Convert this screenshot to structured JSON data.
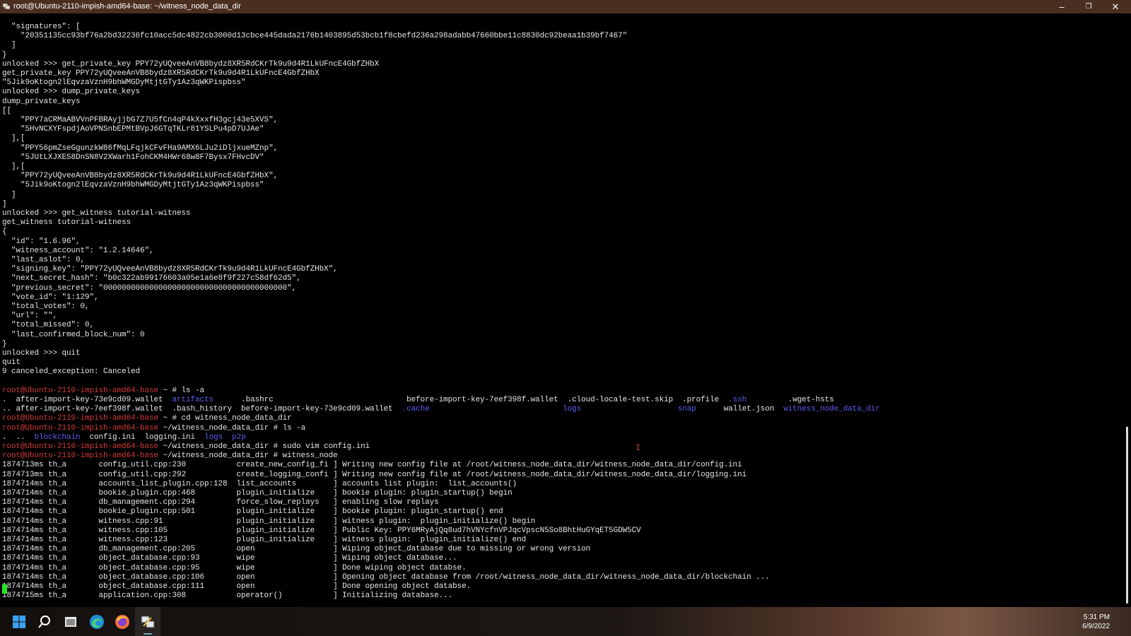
{
  "window": {
    "title": "root@Ubuntu-2110-impish-amd64-base: ~/witness_node_data_dir",
    "minimize_label": "–",
    "maximize_label": "❐",
    "close_label": "✕"
  },
  "terminal": {
    "lines": [
      [
        {
          "t": "  \"signatures\": ["
        }
      ],
      [
        {
          "t": "    \"20351135cc93bf76a2bd32236fc10acc5dc4822cb3000d13cbce445dada2176b1403895d53bcb1f8cbefd236a298adabb47660bbe11c8830dc92beaa1b39bf7467\""
        }
      ],
      [
        {
          "t": "  ]"
        }
      ],
      [
        {
          "t": "}"
        }
      ],
      [
        {
          "t": "unlocked >>> get_private_key PPY72yUQveeAnVB8bydz8XR5RdCKrTk9u9d4R1LkUFncE4GbfZHbX"
        }
      ],
      [
        {
          "t": "get_private_key PPY72yUQveeAnVB8bydz8XR5RdCKrTk9u9d4R1LkUFncE4GbfZHbX"
        }
      ],
      [
        {
          "t": "\"5Jik9oKtogn2lEqvzaVznH9bhWMGDyMtjtGTy1Az3qWKPispbss\""
        }
      ],
      [
        {
          "t": "unlocked >>> dump_private_keys"
        }
      ],
      [
        {
          "t": "dump_private_keys"
        }
      ],
      [
        {
          "t": "[["
        }
      ],
      [
        {
          "t": "    \"PPY7aCRMaABVVnPFBRAyjjbG7Z7U5fCn4qP4kXxxfH3gcj43e5XVS\","
        }
      ],
      [
        {
          "t": "    \"5HvNCXYFspdjAoVPNSnbEPMtBVpJ6GTqTKLr81YSLPu4pD7UJAe\""
        }
      ],
      [
        {
          "t": "  ],["
        }
      ],
      [
        {
          "t": "    \"PPY56pmZseGgunzkW86fMqLFqjkCFvFHa9AMX6LJu2iDljxueMZnp\","
        }
      ],
      [
        {
          "t": "    \"5JUtLXJXES8DnSN8V2XWarh1FohCKM4HWr68w8F7Bysx7FHvcDV\""
        }
      ],
      [
        {
          "t": "  ],["
        }
      ],
      [
        {
          "t": "    \"PPY72yUQveeAnVB8bydz8XR5RdCKrTk9u9d4R1LkUFncE4GbfZHbX\","
        }
      ],
      [
        {
          "t": "    \"5Jik9oKtogn2lEqvzaVznH9bhWMGDyMtjtGTy1Az3qWKPispbss\""
        }
      ],
      [
        {
          "t": "  ]"
        }
      ],
      [
        {
          "t": "]"
        }
      ],
      [
        {
          "t": "unlocked >>> get_witness tutorial-witness"
        }
      ],
      [
        {
          "t": "get_witness tutorial-witness"
        }
      ],
      [
        {
          "t": "{"
        }
      ],
      [
        {
          "t": "  \"id\": \"1.6.96\","
        }
      ],
      [
        {
          "t": "  \"witness_account\": \"1.2.14646\","
        }
      ],
      [
        {
          "t": "  \"last_aslot\": 0,"
        }
      ],
      [
        {
          "t": "  \"signing_key\": \"PPY72yUQveeAnVB8bydz8XR5RdCKrTk9u9d4R1LkUFncE4GbfZHbX\","
        }
      ],
      [
        {
          "t": "  \"next_secret_hash\": \"b0c322ab99176603a05e1a6e8f9f227c58df62d5\","
        }
      ],
      [
        {
          "t": "  \"previous_secret\": \"0000000000000000000000000000000000000000\","
        }
      ],
      [
        {
          "t": "  \"vote_id\": \"1:129\","
        }
      ],
      [
        {
          "t": "  \"total_votes\": 0,"
        }
      ],
      [
        {
          "t": "  \"url\": \"\","
        }
      ],
      [
        {
          "t": "  \"total_missed\": 0,"
        }
      ],
      [
        {
          "t": "  \"last_confirmed_block_num\": 0"
        }
      ],
      [
        {
          "t": "}"
        }
      ],
      [
        {
          "t": "unlocked >>> quit"
        }
      ],
      [
        {
          "t": "quit"
        }
      ],
      [
        {
          "t": "9 canceled_exception: Canceled"
        }
      ],
      [
        {
          "t": ""
        }
      ],
      [
        {
          "t": "root@Ubuntu-2110-impish-amd64-base",
          "c": "red"
        },
        {
          "t": " ~ # ls -a"
        }
      ],
      [
        {
          "t": ".  after-import-key-73e9cd09.wallet  "
        },
        {
          "t": "artifacts",
          "c": "blue"
        },
        {
          "t": "      .bashrc                             before-import-key-7eef398f.wallet  .cloud-locale-test.skip  .profile  "
        },
        {
          "t": ".ssh",
          "c": "blue"
        },
        {
          "t": "         .wget-hsts"
        }
      ],
      [
        {
          "t": ".. after-import-key-7eef398f.wallet  .bash_history  before-import-key-73e9cd09.wallet  "
        },
        {
          "t": ".cache",
          "c": "blue"
        },
        {
          "t": "                             "
        },
        {
          "t": "logs",
          "c": "blue"
        },
        {
          "t": "                     "
        },
        {
          "t": "snap",
          "c": "blue"
        },
        {
          "t": "      wallet.json  "
        },
        {
          "t": "witness_node_data_dir",
          "c": "blue"
        }
      ],
      [
        {
          "t": "root@Ubuntu-2110-impish-amd64-base",
          "c": "red"
        },
        {
          "t": " ~ # cd witness_node_data_dir"
        }
      ],
      [
        {
          "t": "root@Ubuntu-2110-impish-amd64-base",
          "c": "red"
        },
        {
          "t": " ~/witness_node_data_dir # ls -a"
        }
      ],
      [
        {
          "t": ".  ..  "
        },
        {
          "t": "blockchain",
          "c": "blue"
        },
        {
          "t": "  config.ini  logging.ini  "
        },
        {
          "t": "logs",
          "c": "blue"
        },
        {
          "t": "  "
        },
        {
          "t": "p2p",
          "c": "blue"
        }
      ],
      [
        {
          "t": "root@Ubuntu-2110-impish-amd64-base",
          "c": "red"
        },
        {
          "t": " ~/witness_node_data_dir # sudo vim config.ini"
        }
      ],
      [
        {
          "t": "root@Ubuntu-2110-impish-amd64-base",
          "c": "red"
        },
        {
          "t": " ~/witness_node_data_dir # witness_node"
        }
      ],
      [
        {
          "t": "1874713ms th_a       config_util.cpp:230           create_new_config_fi ] Writing new config file at /root/witness_node_data_dir/witness_node_data_dir/config.ini"
        }
      ],
      [
        {
          "t": "1874713ms th_a       config_util.cpp:292           create_logging_confi ] Writing new config file at /root/witness_node_data_dir/witness_node_data_dir/logging.ini"
        }
      ],
      [
        {
          "t": "1874714ms th_a       accounts_list_plugin.cpp:128  list_accounts        ] accounts list plugin:  list_accounts()"
        }
      ],
      [
        {
          "t": "1874714ms th_a       bookie_plugin.cpp:468         plugin_initialize    ] bookie plugin: plugin_startup() begin"
        }
      ],
      [
        {
          "t": "1874714ms th_a       db_management.cpp:294         force_slow_replays   ] enabling slow replays"
        }
      ],
      [
        {
          "t": "1874714ms th_a       bookie_plugin.cpp:501         plugin_initialize    ] bookie plugin: plugin_startup() end"
        }
      ],
      [
        {
          "t": "1874714ms th_a       witness.cpp:91                plugin_initialize    ] witness plugin:  plugin_initialize() begin"
        }
      ],
      [
        {
          "t": "1874714ms th_a       witness.cpp:105               plugin_initialize    ] Public Key: PPY6MRyAjQq8ud7hVNYcfnVPJqcVpscN5So8BhtHuGYqET5GDW5CV"
        }
      ],
      [
        {
          "t": "1874714ms th_a       witness.cpp:123               plugin_initialize    ] witness plugin:  plugin_initialize() end"
        }
      ],
      [
        {
          "t": "1874714ms th_a       db_management.cpp:205         open                 ] Wiping object_database due to missing or wrong version"
        }
      ],
      [
        {
          "t": "1874714ms th_a       object_database.cpp:93        wipe                 ] Wiping object database..."
        }
      ],
      [
        {
          "t": "1874714ms th_a       object_database.cpp:95        wipe                 ] Done wiping object databse."
        }
      ],
      [
        {
          "t": "1874714ms th_a       object_database.cpp:106       open                 ] Opening object database from /root/witness_node_data_dir/witness_node_data_dir/blockchain ..."
        }
      ],
      [
        {
          "t": "1874714ms th_a       object_database.cpp:111       open                 ] Done opening object databse."
        }
      ],
      [
        {
          "t": "1874715ms th_a       application.cpp:308           operator()           ] Initializing database..."
        }
      ]
    ]
  },
  "taskbar": {
    "apps": [
      {
        "icon": "windows-start-icon"
      },
      {
        "icon": "search-icon"
      },
      {
        "icon": "file-explorer-icon"
      },
      {
        "icon": "edge-browser-icon"
      },
      {
        "icon": "firefox-icon"
      },
      {
        "icon": "putty-terminal-icon"
      }
    ],
    "time": "5:31 PM",
    "date": "6/9/2022"
  },
  "colors": {
    "prompt": "#d33a3a",
    "directory": "#5d5df2",
    "text": "#e6e6e6",
    "cursor": "#1fe61f",
    "titlebar": "#4a2f20"
  }
}
